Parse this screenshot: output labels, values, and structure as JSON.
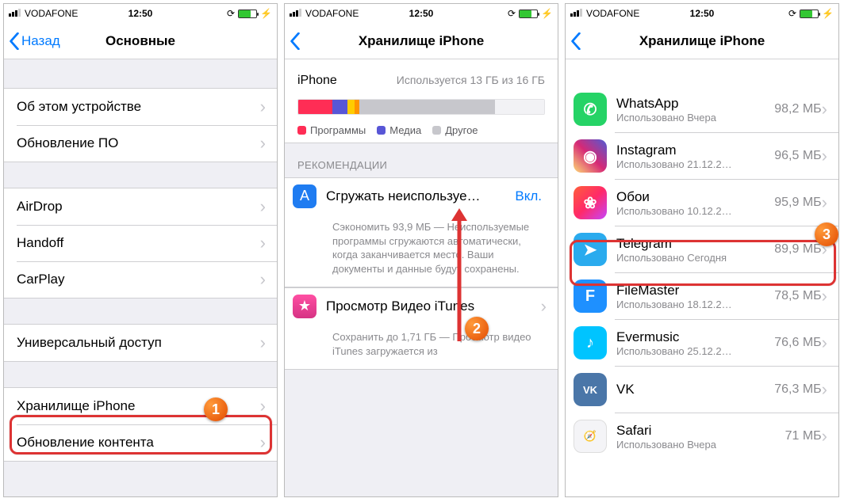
{
  "statusbar": {
    "carrier": "VODAFONE",
    "time": "12:50"
  },
  "phone1": {
    "back": "Назад",
    "title": "Основные",
    "rows": {
      "about": "Об этом устройстве",
      "update": "Обновление ПО",
      "airdrop": "AirDrop",
      "handoff": "Handoff",
      "carplay": "CarPlay",
      "accessibility": "Универсальный доступ",
      "storage": "Хранилище iPhone",
      "refresh": "Обновление контента"
    }
  },
  "phone2": {
    "title": "Хранилище iPhone",
    "storage": {
      "device": "iPhone",
      "usage": "Используется 13 ГБ из 16 ГБ",
      "segments": [
        {
          "color": "#ff2d55",
          "pct": 14
        },
        {
          "color": "#5856d6",
          "pct": 6
        },
        {
          "color": "#ffcc00",
          "pct": 3
        },
        {
          "color": "#ff9500",
          "pct": 2
        },
        {
          "color": "#c7c7cc",
          "pct": 55
        },
        {
          "color": "#f2f2f5",
          "pct": 20
        }
      ],
      "legend": {
        "programs": "Программы",
        "media": "Медиа",
        "other": "Другое"
      }
    },
    "section": "РЕКОМЕНДАЦИИ",
    "offload": {
      "title": "Сгружать неиспользуе…",
      "state": "Вкл.",
      "desc": "Сэкономить 93,9 МБ — Неиспользуемые программы сгружаются автоматически, когда заканчивается место. Ваши документы и данные будут сохранены."
    },
    "itunes": {
      "title": "Просмотр Видео iTunes",
      "desc": "Сохранить до 1,71 ГБ — Просмотр видео iTunes загружается из"
    }
  },
  "phone3": {
    "title": "Хранилище iPhone",
    "apps": [
      {
        "name": "WhatsApp",
        "sub": "Использовано Вчера",
        "size": "98,2 МБ",
        "iconBg": "#25d366",
        "glyph": "✆"
      },
      {
        "name": "Instagram",
        "sub": "Использовано 21.12.2…",
        "size": "96,5 МБ",
        "iconBg": "linear-gradient(45deg,#feda75,#d62976,#4f5bd5)",
        "glyph": "◉"
      },
      {
        "name": "Обои",
        "sub": "Использовано 10.12.2…",
        "size": "95,9 МБ",
        "iconBg": "linear-gradient(135deg,#ff5e3a,#ff2a68,#c644fc)",
        "glyph": "❀"
      },
      {
        "name": "Telegram",
        "sub": "Использовано Сегодня",
        "size": "89,9 МБ",
        "iconBg": "#2aabee",
        "glyph": "➤"
      },
      {
        "name": "FileMaster",
        "sub": "Использовано 18.12.2…",
        "size": "78,5 МБ",
        "iconBg": "#1e90ff",
        "glyph": "F"
      },
      {
        "name": "Evermusic",
        "sub": "Использовано 25.12.2…",
        "size": "76,6 МБ",
        "iconBg": "#00c4ff",
        "glyph": "♪"
      },
      {
        "name": "VK",
        "sub": "",
        "size": "76,3 МБ",
        "iconBg": "#4a76a8",
        "glyph": "VK"
      },
      {
        "name": "Safari",
        "sub": "Использовано Вчера",
        "size": "71 МБ",
        "iconBg": "#f4f4f7",
        "glyph": "🧭"
      }
    ]
  },
  "badges": {
    "one": "1",
    "two": "2",
    "three": "3"
  }
}
